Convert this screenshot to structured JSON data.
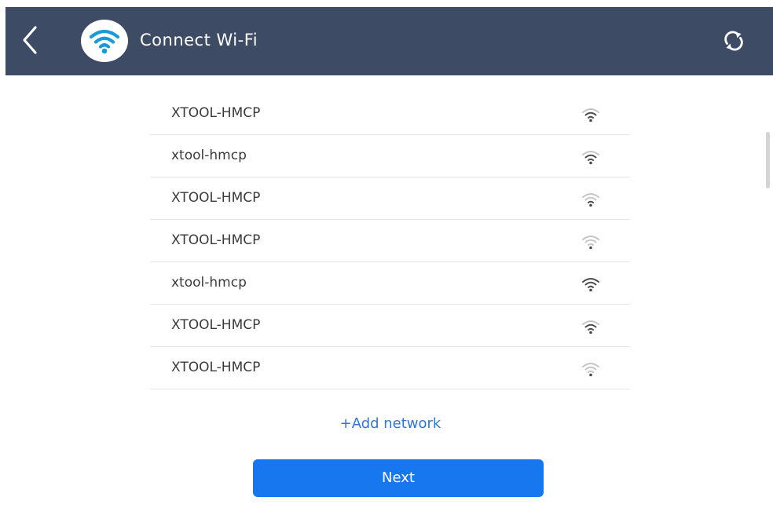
{
  "header": {
    "title": "Connect Wi-Fi",
    "back_icon": "chevron-left-icon",
    "logo_icon": "wifi-icon",
    "refresh_icon": "refresh-icon",
    "background_color": "#3e4b64"
  },
  "networks": [
    {
      "ssid": "XTOOL-HMCP",
      "signal": 0.6
    },
    {
      "ssid": "xtool-hmcp",
      "signal": 0.6
    },
    {
      "ssid": "XTOOL-HMCP",
      "signal": 0.45
    },
    {
      "ssid": "XTOOL-HMCP",
      "signal": 0.3
    },
    {
      "ssid": "xtool-hmcp",
      "signal": 1.0
    },
    {
      "ssid": "XTOOL-HMCP",
      "signal": 0.75
    },
    {
      "ssid": "XTOOL-HMCP",
      "signal": 0.3
    }
  ],
  "add_network_label": "+Add network",
  "next_button_label": "Next",
  "colors": {
    "accent": "#1677ef",
    "link": "#2f77d6"
  }
}
